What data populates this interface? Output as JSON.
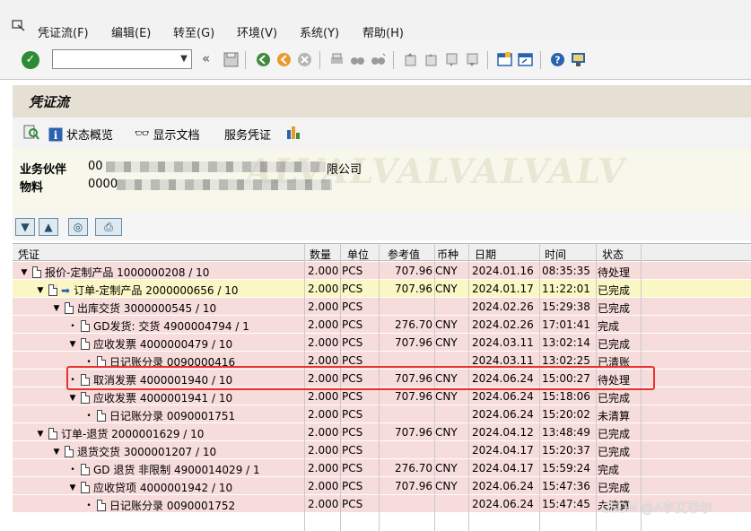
{
  "menu": {
    "items": [
      "凭证流(F)",
      "编辑(E)",
      "转至(G)",
      "环境(V)",
      "系统(Y)",
      "帮助(H)"
    ]
  },
  "toolbar": {
    "command_value": "",
    "icons": [
      "enter-icon",
      "back-icon",
      "save-icon",
      "exit-icon",
      "cancel-icon",
      "print-icon",
      "find-icon",
      "find-next-icon",
      "first-page-icon",
      "prev-page-icon",
      "next-page-icon",
      "last-page-icon",
      "new-session-icon",
      "shortcut-icon",
      "help-icon",
      "layout-icon"
    ]
  },
  "title": "凭证流",
  "app_toolbar": {
    "status_overview": "状态概览",
    "display_doc": "显示文档",
    "service_doc": "服务凭证"
  },
  "header": {
    "partner_label": "业务伙伴",
    "partner_value": "00",
    "partner_suffix": "限公司",
    "material_label": "物料",
    "material_value": "0000",
    "watermark": "ALVALVALVALVALV"
  },
  "columns": {
    "doc": "凭证",
    "qty": "数量",
    "unit": "单位",
    "ref": "参考值",
    "cur": "币种",
    "date": "日期",
    "time": "时间",
    "status": "状态"
  },
  "rows": [
    {
      "level": 0,
      "tri": "▼",
      "arrow": false,
      "text": "报价-定制产品 1000000208 / 10",
      "qty": "2.000",
      "unit": "PCS",
      "ref": "707.96",
      "cur": "CNY",
      "date": "2024.01.16",
      "time": "08:35:35",
      "status": "待处理",
      "bg": "pink"
    },
    {
      "level": 1,
      "tri": "▼",
      "arrow": true,
      "text": "订单-定制产品 2000000656 / 10",
      "qty": "2.000",
      "unit": "PCS",
      "ref": "707.96",
      "cur": "CNY",
      "date": "2024.01.17",
      "time": "11:22:01",
      "status": "已完成",
      "bg": "yellow"
    },
    {
      "level": 2,
      "tri": "▼",
      "arrow": false,
      "text": "出库交货 3000000545 / 10",
      "qty": "2.000",
      "unit": "PCS",
      "ref": "",
      "cur": "",
      "date": "2024.02.26",
      "time": "15:29:38",
      "status": "已完成",
      "bg": "pink"
    },
    {
      "level": 3,
      "tri": "•",
      "arrow": false,
      "text": "GD发货: 交货 4900004794 / 1",
      "qty": "2.000",
      "unit": "PCS",
      "ref": "276.70",
      "cur": "CNY",
      "date": "2024.02.26",
      "time": "17:01:41",
      "status": "完成",
      "bg": "pink"
    },
    {
      "level": 3,
      "tri": "▼",
      "arrow": false,
      "text": "应收发票 4000000479 / 10",
      "qty": "2.000",
      "unit": "PCS",
      "ref": "707.96",
      "cur": "CNY",
      "date": "2024.03.11",
      "time": "13:02:14",
      "status": "已完成",
      "bg": "pink"
    },
    {
      "level": 4,
      "tri": "•",
      "arrow": false,
      "text": "日记账分录 0090000416",
      "qty": "2.000",
      "unit": "PCS",
      "ref": "",
      "cur": "",
      "date": "2024.03.11",
      "time": "13:02:25",
      "status": "已清账",
      "bg": "pink"
    },
    {
      "level": 3,
      "tri": "•",
      "arrow": false,
      "text": "取消发票 4000001940 / 10",
      "qty": "2.000",
      "unit": "PCS",
      "ref": "707.96",
      "cur": "CNY",
      "date": "2024.06.24",
      "time": "15:00:27",
      "status": "待处理",
      "bg": "pink"
    },
    {
      "level": 3,
      "tri": "▼",
      "arrow": false,
      "text": "应收发票 4000001941 / 10",
      "qty": "2.000",
      "unit": "PCS",
      "ref": "707.96",
      "cur": "CNY",
      "date": "2024.06.24",
      "time": "15:18:06",
      "status": "已完成",
      "bg": "pink"
    },
    {
      "level": 4,
      "tri": "•",
      "arrow": false,
      "text": "日记账分录 0090001751",
      "qty": "2.000",
      "unit": "PCS",
      "ref": "",
      "cur": "",
      "date": "2024.06.24",
      "time": "15:20:02",
      "status": "未清算",
      "bg": "pink"
    },
    {
      "level": 1,
      "tri": "▼",
      "arrow": false,
      "text": "订单-退货 2000001629 / 10",
      "qty": "2.000",
      "unit": "PCS",
      "ref": "707.96",
      "cur": "CNY",
      "date": "2024.04.12",
      "time": "13:48:49",
      "status": "已完成",
      "bg": "pink"
    },
    {
      "level": 2,
      "tri": "▼",
      "arrow": false,
      "text": "退货交货 3000001207 / 10",
      "qty": "2.000",
      "unit": "PCS",
      "ref": "",
      "cur": "",
      "date": "2024.04.17",
      "time": "15:20:37",
      "status": "已完成",
      "bg": "pink"
    },
    {
      "level": 3,
      "tri": "•",
      "arrow": false,
      "text": "GD 退货 非限制 4900014029 / 1",
      "qty": "2.000",
      "unit": "PCS",
      "ref": "276.70",
      "cur": "CNY",
      "date": "2024.04.17",
      "time": "15:59:24",
      "status": "完成",
      "bg": "pink"
    },
    {
      "level": 3,
      "tri": "▼",
      "arrow": false,
      "text": "应收贷项 4000001942 / 10",
      "qty": "2.000",
      "unit": "PCS",
      "ref": "707.96",
      "cur": "CNY",
      "date": "2024.06.24",
      "time": "15:47:36",
      "status": "已完成",
      "bg": "pink"
    },
    {
      "level": 4,
      "tri": "•",
      "arrow": false,
      "text": "日记账分录 0090001752",
      "qty": "2.000",
      "unit": "PCS",
      "ref": "",
      "cur": "",
      "date": "2024.06.24",
      "time": "15:47:45",
      "status": "未清算",
      "bg": "pink"
    }
  ],
  "watermark_csdn": "CSDN @A李艾菲尔"
}
